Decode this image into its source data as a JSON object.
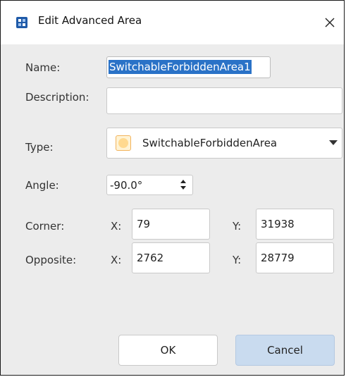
{
  "window": {
    "title": "Edit Advanced Area",
    "close_glyph": "✕"
  },
  "form": {
    "name_label": "Name:",
    "name_value": "SwitchableForbiddenArea1",
    "description_label": "Description:",
    "description_value": "",
    "type_label": "Type:",
    "type_value": "SwitchableForbiddenArea",
    "angle_label": "Angle:",
    "angle_value": "-90.0°",
    "corner_label": "Corner:",
    "corner_x_label": "X:",
    "corner_x_value": "79",
    "corner_y_label": "Y:",
    "corner_y_value": "31938",
    "opposite_label": "Opposite:",
    "opposite_x_label": "X:",
    "opposite_x_value": "2762",
    "opposite_y_label": "Y:",
    "opposite_y_value": "28779"
  },
  "buttons": {
    "ok_label": "OK",
    "cancel_label": "Cancel"
  },
  "colors": {
    "selection": "#2a72c7",
    "cancel_bg": "#c9dbef",
    "dialog_bg": "#ececec"
  },
  "icons": {
    "app": "grid-app-icon",
    "close": "close-icon",
    "type": "area-swatch-icon",
    "dropdown": "chevron-down-icon",
    "spin": "spinner-arrows-icon"
  }
}
